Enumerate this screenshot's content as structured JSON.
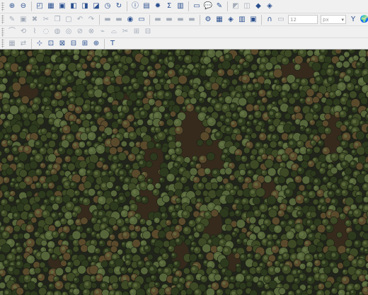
{
  "toolbars": {
    "row1": [
      {
        "name": "zoom-in-icon",
        "glyph": "⊕",
        "disabled": false
      },
      {
        "name": "zoom-out-icon",
        "glyph": "⊖",
        "disabled": false
      },
      {
        "sep": true
      },
      {
        "name": "zoom-layer-icon",
        "glyph": "◰",
        "disabled": false
      },
      {
        "name": "zoom-selection-icon",
        "glyph": "▦",
        "disabled": false
      },
      {
        "name": "zoom-native-icon",
        "glyph": "▣",
        "disabled": false
      },
      {
        "name": "zoom-last-icon",
        "glyph": "◧",
        "disabled": false
      },
      {
        "name": "zoom-next-icon",
        "glyph": "◨",
        "disabled": false
      },
      {
        "name": "new-bookmark-icon",
        "glyph": "◪",
        "disabled": false
      },
      {
        "name": "temporal-controller-icon",
        "glyph": "◷",
        "disabled": false
      },
      {
        "name": "refresh-icon",
        "glyph": "↻",
        "disabled": false
      },
      {
        "sep": true
      },
      {
        "name": "identify-icon",
        "glyph": "ⓘ",
        "disabled": false
      },
      {
        "name": "attribute-table-icon",
        "glyph": "▤",
        "disabled": false
      },
      {
        "name": "settings-icon",
        "glyph": "✹",
        "disabled": false
      },
      {
        "name": "statistics-icon",
        "glyph": "Σ",
        "disabled": false
      },
      {
        "name": "field-calculator-icon",
        "glyph": "▥",
        "disabled": false
      },
      {
        "sep": true
      },
      {
        "name": "measure-icon",
        "glyph": "▭",
        "disabled": false
      },
      {
        "name": "map-tips-icon",
        "glyph": "💬",
        "disabled": false
      },
      {
        "name": "annotation-icon",
        "glyph": "✎",
        "disabled": false
      },
      {
        "sep": true
      },
      {
        "name": "select-features-icon",
        "glyph": "◩",
        "disabled": true
      },
      {
        "name": "deselect-icon",
        "glyph": "◫",
        "disabled": true
      },
      {
        "name": "layer-style-icon",
        "glyph": "◆",
        "disabled": false
      },
      {
        "name": "label-tool-icon",
        "glyph": "◈",
        "disabled": false
      }
    ],
    "row2": [
      {
        "name": "digitize-toggle-icon",
        "glyph": "✎",
        "disabled": true
      },
      {
        "name": "save-edits-icon",
        "glyph": "▣",
        "disabled": true
      },
      {
        "name": "delete-feature-icon",
        "glyph": "✖",
        "disabled": true
      },
      {
        "name": "cut-features-icon",
        "glyph": "✂",
        "disabled": true
      },
      {
        "name": "copy-features-icon",
        "glyph": "❐",
        "disabled": true
      },
      {
        "name": "paste-features-icon",
        "glyph": "▢",
        "disabled": true
      },
      {
        "name": "undo-icon",
        "glyph": "↶",
        "disabled": true
      },
      {
        "name": "redo-icon",
        "glyph": "↷",
        "disabled": true
      },
      {
        "sep": true
      },
      {
        "name": "label-pin-icon",
        "glyph": "▬",
        "disabled": true
      },
      {
        "name": "label-show-icon",
        "glyph": "▬",
        "disabled": true
      },
      {
        "name": "label-highlight-icon",
        "glyph": "◉",
        "disabled": false
      },
      {
        "name": "label-move-icon",
        "glyph": "▭",
        "disabled": false
      },
      {
        "sep": true
      },
      {
        "name": "label-rotate-icon",
        "glyph": "▬",
        "disabled": true
      },
      {
        "name": "label-change-icon",
        "glyph": "▬",
        "disabled": true
      },
      {
        "name": "label-props-icon",
        "glyph": "▬",
        "disabled": true
      },
      {
        "name": "label-diagram-icon",
        "glyph": "▬",
        "disabled": true
      },
      {
        "sep": true
      },
      {
        "name": "python-icon",
        "glyph": "⚙",
        "disabled": false
      },
      {
        "name": "plugin-a-icon",
        "glyph": "▦",
        "disabled": false
      },
      {
        "name": "plugin-b-icon",
        "glyph": "◈",
        "disabled": false
      },
      {
        "name": "plugin-c-icon",
        "glyph": "▥",
        "disabled": false
      },
      {
        "name": "plugin-d-icon",
        "glyph": "▣",
        "disabled": false
      },
      {
        "sep": true
      },
      {
        "name": "magnet-icon",
        "glyph": "∩",
        "disabled": false
      },
      {
        "name": "snapping-icon",
        "glyph": "▭",
        "disabled": true
      },
      {
        "name": "snap-tolerance-field",
        "input": "12",
        "width": 36
      },
      {
        "name": "snap-units-combo",
        "input": "px",
        "width": 30,
        "combo": true
      },
      {
        "name": "tracing-icon",
        "glyph": "Y",
        "disabled": false
      },
      {
        "name": "topology-icon",
        "glyph": "🌍",
        "disabled": false
      },
      {
        "name": "advanced-digitize-icon",
        "glyph": "◆",
        "disabled": false
      }
    ],
    "row3": [
      {
        "name": "curve-tool-icon",
        "glyph": "⌒",
        "disabled": true
      },
      {
        "name": "rotate-feature-icon",
        "glyph": "⟲",
        "disabled": true
      },
      {
        "name": "simplify-icon",
        "glyph": "⌇",
        "disabled": true
      },
      {
        "name": "add-ring-icon",
        "glyph": "◌",
        "disabled": true
      },
      {
        "name": "add-part-icon",
        "glyph": "◍",
        "disabled": true
      },
      {
        "name": "fill-ring-icon",
        "glyph": "◎",
        "disabled": true
      },
      {
        "name": "delete-ring-icon",
        "glyph": "⊘",
        "disabled": true
      },
      {
        "name": "delete-part-icon",
        "glyph": "⊗",
        "disabled": true
      },
      {
        "name": "reshape-icon",
        "glyph": "⌁",
        "disabled": true
      },
      {
        "name": "offset-curve-icon",
        "glyph": "⌓",
        "disabled": true
      },
      {
        "name": "split-features-icon",
        "glyph": "✂",
        "disabled": true
      },
      {
        "name": "merge-features-icon",
        "glyph": "⊞",
        "disabled": true
      },
      {
        "name": "merge-attributes-icon",
        "glyph": "⊟",
        "disabled": true
      }
    ],
    "row4": [
      {
        "name": "vertex-tool-icon",
        "glyph": "▦",
        "disabled": true
      },
      {
        "name": "reverse-line-icon",
        "glyph": "⇄",
        "disabled": true
      },
      {
        "sep": true
      },
      {
        "name": "georeferencer-icon",
        "glyph": "⊹",
        "disabled": false
      },
      {
        "name": "align-rasters-icon",
        "glyph": "⊡",
        "disabled": false
      },
      {
        "name": "raster-calc-icon",
        "glyph": "⊠",
        "disabled": false
      },
      {
        "name": "raster-clip-icon",
        "glyph": "⊟",
        "disabled": false
      },
      {
        "name": "raster-merge-icon",
        "glyph": "⊞",
        "disabled": false
      },
      {
        "name": "raster-translate-icon",
        "glyph": "⊕",
        "disabled": false
      },
      {
        "sep": true
      },
      {
        "name": "text-annotation-icon",
        "glyph": "T",
        "disabled": false
      }
    ]
  },
  "map": {
    "content": "aerial-forest-canopy",
    "palette": {
      "ground": "#20241a",
      "clearing": "#3b2c1e",
      "crown_dark": "#2e3a1d",
      "crown_mid": "#3d4a25",
      "crown_light": "#56663a",
      "crown_brown": "#5a4a2c",
      "highlight": "#6f7d4a"
    }
  }
}
